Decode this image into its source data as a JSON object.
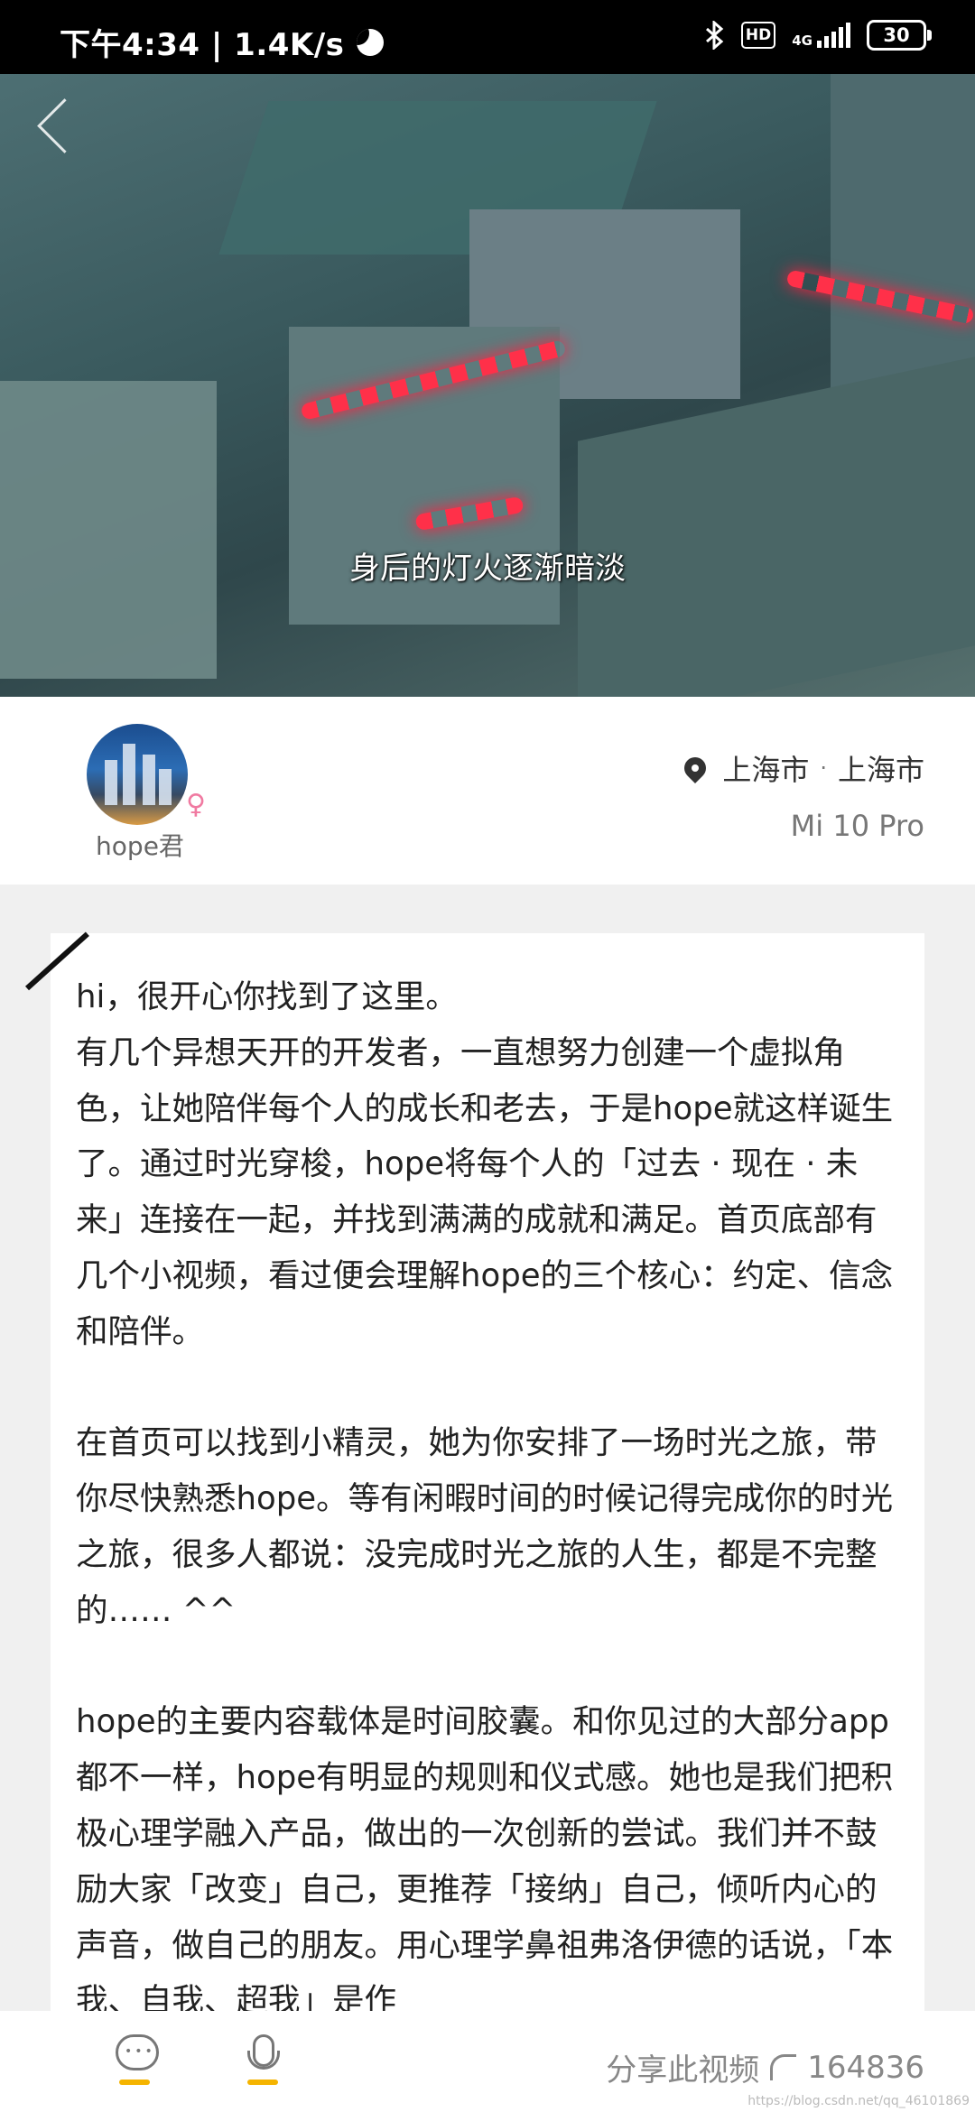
{
  "status_bar": {
    "time": "下午4:34 | 1.4K/s",
    "hd": "HD",
    "network": "4G",
    "battery": "30"
  },
  "video": {
    "subtitle": "身后的灯火逐渐暗淡"
  },
  "author": {
    "name": "hope君",
    "gender_symbol": "♀",
    "location_city1": "上海市",
    "location_sep": "·",
    "location_city2": "上海市",
    "device": "Mi 10 Pro"
  },
  "content": {
    "paragraph1": "hi，很开心你找到了这里。\n有几个异想天开的开发者，一直想努力创建一个虚拟角色，让她陪伴每个人的成长和老去，于是hope就这样诞生了。通过时光穿梭，hope将每个人的「过去 · 现在 · 未来」连接在一起，并找到满满的成就和满足。首页底部有几个小视频，看过便会理解hope的三个核心：约定、信念和陪伴。",
    "paragraph2": "在首页可以找到小精灵，她为你安排了一场时光之旅，带你尽快熟悉hope。等有闲暇时间的时候记得完成你的时光之旅，很多人都说：没完成时光之旅的人生，都是不完整的…… ^^",
    "paragraph3": "hope的主要内容载体是时间胶囊。和你见过的大部分app都不一样，hope有明显的规则和仪式感。她也是我们把积极心理学融入产品，做出的一次创新的尝试。我们并不鼓励大家「改变」自己，更推荐「接纳」自己，倾听内心的声音，做自己的朋友。用心理学鼻祖弗洛伊德的话说，「本我、自我、超我」是作"
  },
  "bottom_bar": {
    "share_label": "分享此视频",
    "share_count": "164836",
    "watermark": "https://blog.csdn.net/qq_46101869"
  },
  "colors": {
    "accent_yellow": "#f5b400",
    "female_pink": "#f07aa1",
    "lamp_red": "#ff3049"
  }
}
